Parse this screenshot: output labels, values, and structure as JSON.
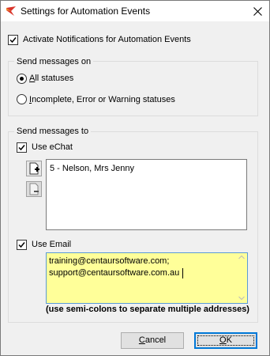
{
  "window": {
    "title": "Settings for Automation Events",
    "icon": "centaur-app-icon",
    "close_icon": "close-icon"
  },
  "activate": {
    "label": "Activate Notifications for Automation Events",
    "checked": true
  },
  "send_on": {
    "title": "Send messages on",
    "options": [
      {
        "label_prefix": "",
        "label_accel": "A",
        "label_rest": "ll statuses",
        "selected": true
      },
      {
        "label_prefix": "",
        "label_accel": "I",
        "label_rest": "ncomplete, Error or Warning statuses",
        "selected": false
      }
    ]
  },
  "send_to": {
    "title": "Send messages to",
    "echat": {
      "label": "Use eChat",
      "checked": true,
      "recipients": [
        "5 - Nelson, Mrs Jenny"
      ],
      "add_icon": "add-recipient-icon",
      "remove_icon": "remove-recipient-icon"
    },
    "email": {
      "label": "Use Email",
      "checked": true,
      "lines": [
        "training@centaursoftware.com;",
        "support@centaursoftware.com.au"
      ],
      "hint": "(use semi-colons to separate multiple addresses)"
    }
  },
  "buttons": {
    "cancel": {
      "accel": "C",
      "rest": "ancel"
    },
    "ok": {
      "accel": "O",
      "rest": "K"
    }
  }
}
